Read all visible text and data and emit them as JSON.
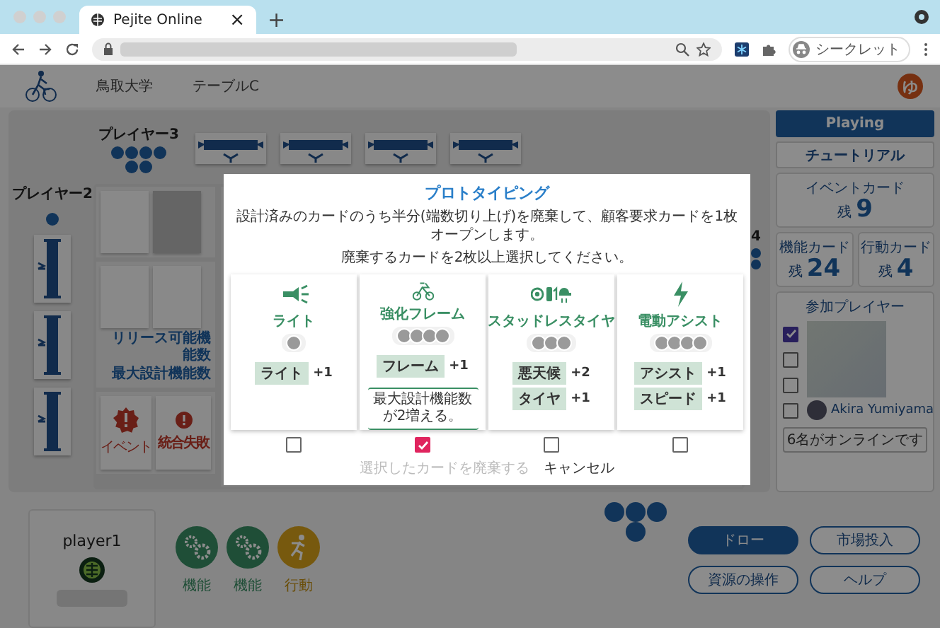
{
  "browser": {
    "tab_title": "Pejite Online",
    "tab_close": "×",
    "new_tab": "+",
    "profile_label": "シークレット"
  },
  "header": {
    "university": "鳥取大学",
    "table": "テーブルC",
    "avatar_initial": "ゆ"
  },
  "board": {
    "top_player": {
      "name": "プレイヤー3"
    },
    "left_player": {
      "name": "プレイヤー2"
    },
    "right_player": {
      "name": "4"
    },
    "mat": {
      "release_label": "リリース可能機能数",
      "max_label": "最大設計機能数",
      "event_card": {
        "label": "イベント"
      },
      "failure_card": {
        "title": "統合失敗"
      }
    }
  },
  "sidebar": {
    "menu": [
      {
        "label": "Playing",
        "selected": true
      },
      {
        "label": "チュートリアル",
        "selected": false
      }
    ],
    "decks": [
      {
        "title": "イベントカード",
        "prefix": "残",
        "count": "9"
      },
      {
        "title": "機能カード",
        "prefix": "残",
        "count": "24"
      },
      {
        "title": "行動カード",
        "prefix": "残",
        "count": "4"
      }
    ],
    "participants": {
      "title": "参加プレイヤー",
      "rows": [
        {
          "checked": true
        },
        {
          "checked": false
        },
        {
          "checked": false
        },
        {
          "checked": false,
          "name": "Akira Yumiyama"
        }
      ],
      "online": "6名がオンラインです"
    }
  },
  "player": {
    "name": "player1"
  },
  "resources": [
    {
      "kind": "function",
      "label": "機能"
    },
    {
      "kind": "function",
      "label": "機能"
    },
    {
      "kind": "action",
      "label": "行動"
    }
  ],
  "actions": [
    {
      "label": "ドロー",
      "primary": true
    },
    {
      "label": "市場投入",
      "primary": false
    },
    {
      "label": "資源の操作",
      "primary": false
    },
    {
      "label": "ヘルプ",
      "primary": false
    }
  ],
  "dialog": {
    "title": "プロトタイピング",
    "lines": [
      "設計済みのカードのうち半分(端数切り上げ)を廃棄して、顧客要求カードを1枚オープンします。",
      "廃棄するカードを2枚以上選択してください。"
    ],
    "cards": [
      {
        "kind": "light",
        "title": "ライト",
        "tokens": [
          {
            "kind": "cost"
          }
        ],
        "tags": [
          {
            "label": "ライト",
            "bonus": "+1"
          }
        ],
        "selected": false
      },
      {
        "kind": "frame",
        "title": "強化フレーム",
        "tokens": [
          {
            "kind": "cost"
          },
          {
            "kind": "cost"
          },
          {
            "kind": "cost"
          },
          {
            "kind": "cost"
          }
        ],
        "tags": [
          {
            "label": "フレーム",
            "bonus": "+1"
          }
        ],
        "effect": "最大設計機能数が2増える。",
        "selected": true
      },
      {
        "kind": "tire",
        "title": "スタッドレスタイヤ",
        "tokens": [
          {
            "kind": "cost"
          },
          {
            "kind": "cost"
          },
          {
            "kind": "cost"
          }
        ],
        "tags": [
          {
            "label": "悪天候",
            "bonus": "+2"
          },
          {
            "label": "タイヤ",
            "bonus": "+1"
          }
        ],
        "selected": false
      },
      {
        "kind": "assist",
        "title": "電動アシスト",
        "tokens": [
          {
            "kind": "cost"
          },
          {
            "kind": "cost"
          },
          {
            "kind": "cost"
          },
          {
            "kind": "cost"
          }
        ],
        "tags": [
          {
            "label": "アシスト",
            "bonus": "+1"
          },
          {
            "label": "スピード",
            "bonus": "+1"
          }
        ],
        "selected": false
      }
    ],
    "discard": {
      "label": "選択したカードを廃棄する",
      "disabled": true
    },
    "cancel": {
      "label": "キャンセル"
    }
  }
}
